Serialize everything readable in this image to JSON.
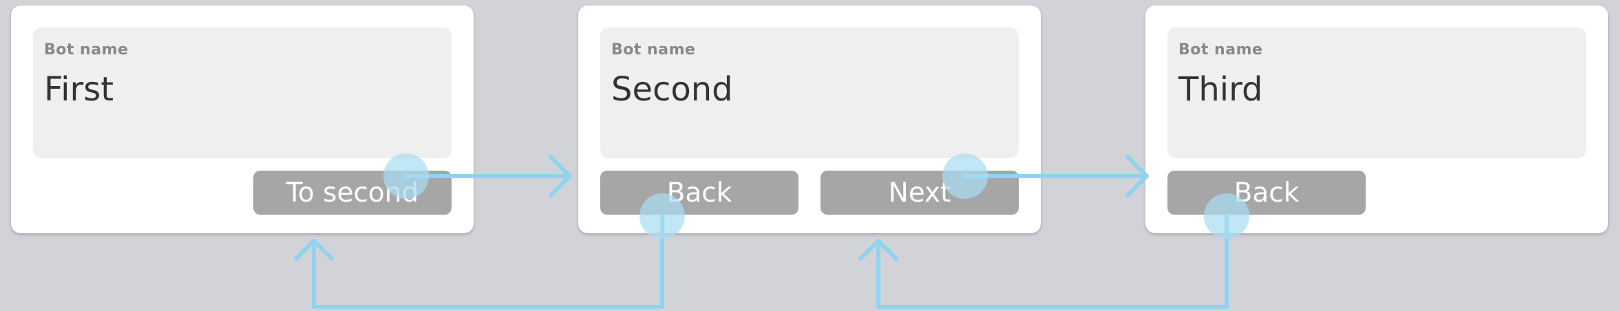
{
  "screens": [
    {
      "field_label": "Bot name",
      "field_value": "First",
      "buttons": [
        "To second"
      ]
    },
    {
      "field_label": "Bot name",
      "field_value": "Second",
      "buttons": [
        "Back",
        "Next"
      ]
    },
    {
      "field_label": "Bot name",
      "field_value": "Third",
      "buttons": [
        "Back"
      ]
    }
  ],
  "colors": {
    "background": "#d2d3d8",
    "card": "#ffffff",
    "field": "#efefef",
    "button": "#a6a6a6",
    "connector": "#8fd3f0"
  }
}
